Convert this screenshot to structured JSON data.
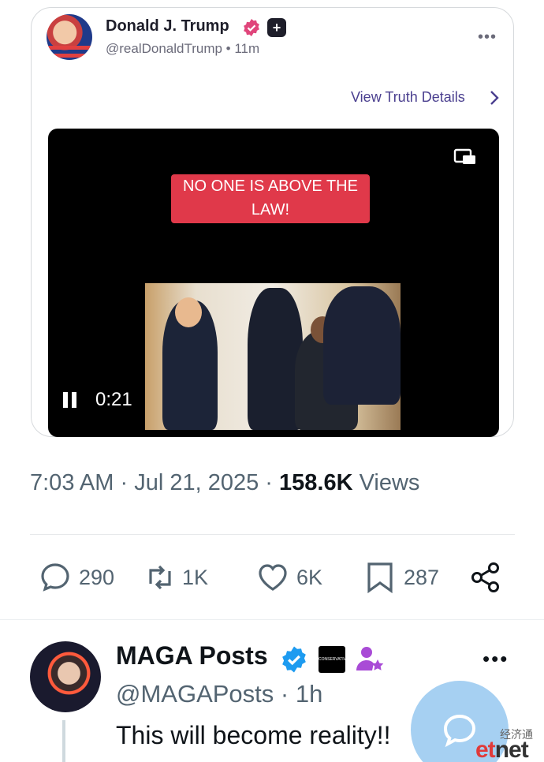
{
  "card": {
    "name": "Donald J. Trump",
    "handle": "@realDonaldTrump • 11m",
    "more": "•••",
    "view_details": "View Truth Details",
    "icons": {
      "verified": "verified-badge-icon",
      "plus": "truth-plus-icon",
      "chevron": "chevron-right-icon",
      "pip": "picture-in-picture-icon",
      "pause": "pause-icon"
    },
    "video": {
      "banner_line1": "NO ONE IS ABOVE THE",
      "banner_line2": "LAW!",
      "time": "0:21"
    }
  },
  "meta": {
    "time": "7:03 AM",
    "date": "Jul 21, 2025",
    "views_count": "158.6K",
    "views_label": "Views",
    "sep": "·"
  },
  "actions": {
    "replies": "290",
    "reposts": "1K",
    "likes": "6K",
    "bookmarks": "287"
  },
  "reply": {
    "name": "MAGA Posts",
    "handle": "@MAGAPosts · 1h",
    "text": "This will become reality!!",
    "square_label": "CONSERVATIVE",
    "more": "•••"
  },
  "watermark": {
    "cn": "经济通",
    "logo_a": "et",
    "logo_b": "net"
  },
  "colors": {
    "accent": "#1d9bf0",
    "verified_pink": "#e0457b",
    "banner": "#e0394a",
    "fab": "#a6d0f2"
  }
}
